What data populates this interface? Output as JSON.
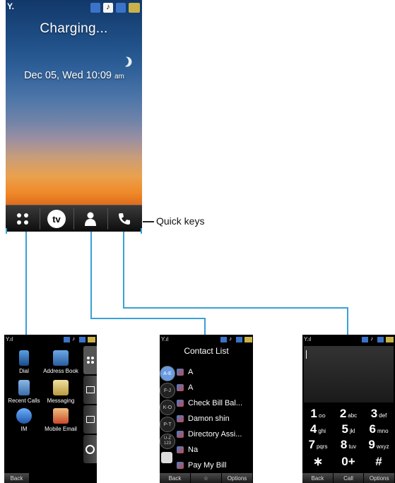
{
  "main_screen": {
    "charging_text": "Charging...",
    "date_text": "Dec 05, Wed",
    "time_text": "10:09",
    "ampm_text": "am",
    "quick_keys": [
      {
        "icon": "menu-dots-icon"
      },
      {
        "icon": "tv-icon",
        "label": "tv"
      },
      {
        "icon": "contacts-person-icon"
      },
      {
        "icon": "phone-handset-icon"
      }
    ]
  },
  "callout": {
    "label": "Quick keys"
  },
  "menu_screen": {
    "items": [
      "Dial",
      "Address Book",
      "Recent Calls",
      "Messaging",
      "IM",
      "Mobile Email"
    ],
    "softkey_back": "Back"
  },
  "contacts_screen": {
    "title": "Contact List",
    "index_tabs": [
      "A-E",
      "F-J",
      "K-O",
      "P-T",
      "U-Z 123"
    ],
    "contacts": [
      "A",
      "A",
      "Check Bill Bal...",
      "Damon shin",
      "Directory Assi...",
      "Na",
      "Pay My Bill"
    ],
    "softkeys": [
      "Back",
      "☆",
      "Options"
    ]
  },
  "dialer_screen": {
    "keys": [
      {
        "num": "1",
        "letters": "ᴑᴑ"
      },
      {
        "num": "2",
        "letters": "abc"
      },
      {
        "num": "3",
        "letters": "def"
      },
      {
        "num": "4",
        "letters": "ghi"
      },
      {
        "num": "5",
        "letters": "jkl"
      },
      {
        "num": "6",
        "letters": "mno"
      },
      {
        "num": "7",
        "letters": "pqrs"
      },
      {
        "num": "8",
        "letters": "tuv"
      },
      {
        "num": "9",
        "letters": "wxyz"
      },
      {
        "num": "∗",
        "letters": ""
      },
      {
        "num": "0+",
        "letters": ""
      },
      {
        "num": "#",
        "letters": ""
      }
    ],
    "softkeys": [
      "Back",
      "Call",
      "Options"
    ]
  }
}
